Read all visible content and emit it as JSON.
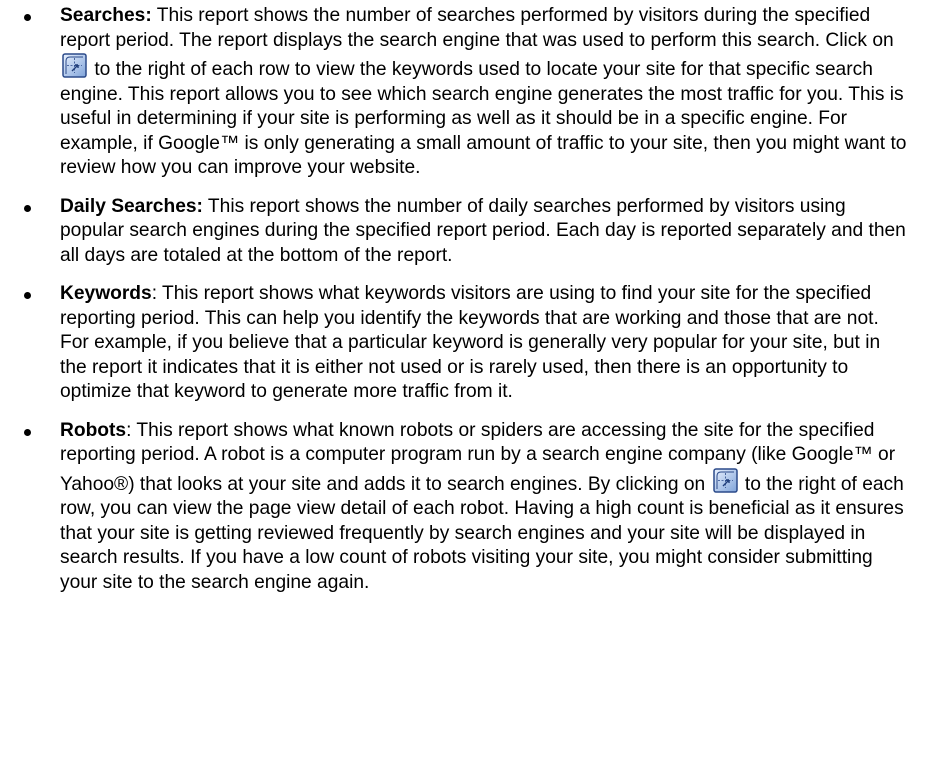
{
  "items": [
    {
      "term": "Searches:",
      "text1": " This report shows the number of searches performed by visitors during the specified report period. The report displays the search engine that was used to perform this search. Click on ",
      "icon": "drill-down-icon",
      "text2": " to the right of each row to view the keywords used to locate your site for that specific search engine. This report allows you to see which search engine generates the most traffic for you. This is useful in determining if your site is performing as well as it should be in a specific engine. For example, if Google™ is only generating a small amount of traffic to your site, then you might want to review how you can improve your website."
    },
    {
      "term": "Daily Searches:",
      "text1": " This report shows the number of daily searches performed by visitors using popular search engines during the specified report period. Each day is reported separately and then all days are totaled at the bottom of the report."
    },
    {
      "term": "Keywords",
      "text1": ": This report shows what keywords visitors are using to find your site for the specified reporting period. This can help you identify the keywords that are working and those that are not. For example, if you believe that a particular keyword is generally very popular for your site, but in the report it indicates that it is either not used or is rarely used, then there is an opportunity to optimize that keyword to generate more traffic from it."
    },
    {
      "term": "Robots",
      "text1": ": This report shows what known robots or spiders are accessing the site for the specified reporting period. A robot is a computer program run by a search engine company (like Google™ or Yahoo®) that looks at your site and adds it to search engines. By clicking on ",
      "icon": "drill-down-icon",
      "text2": " to the right of each row, you can view the page view detail of each robot. Having a high count is beneficial as it ensures that your site is getting reviewed frequently by search engines and your site will be displayed in search results. If you have a low count of robots visiting your site, you might consider submitting your site to the search engine again."
    }
  ],
  "colors": {
    "text": "#000000",
    "icon_border": "#2b4a8a",
    "icon_fill_top": "#eaf2ff",
    "icon_fill_bottom": "#7fa3d9"
  }
}
